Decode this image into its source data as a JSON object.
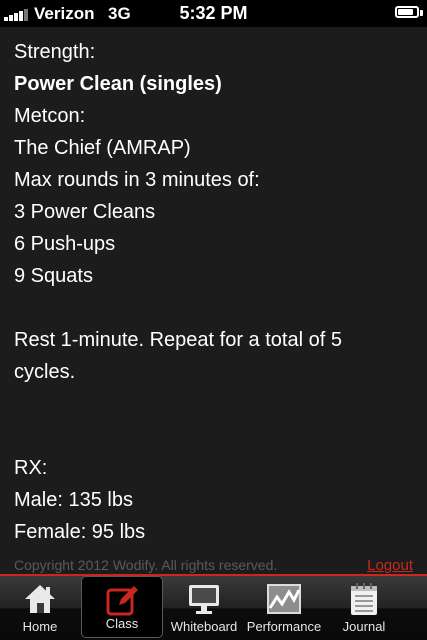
{
  "status_bar": {
    "carrier": "Verizon",
    "network": "3G",
    "time": "5:32 PM",
    "battery_level": 0.85
  },
  "workout": {
    "strength_heading": "Strength:",
    "strength_movement": "Power Clean  (singles)",
    "metcon_heading": "Metcon:",
    "metcon_name": "The Chief  (AMRAP)",
    "lines": [
      "Max rounds in 3 minutes of:",
      "3 Power Cleans",
      "6 Push-ups",
      "9 Squats"
    ],
    "rest_line_1": "Rest 1-minute. Repeat for a total of 5",
    "rest_line_2": "cycles.",
    "rx_heading": "RX:",
    "rx_male": "Male:  135 lbs",
    "rx_female": "Female:  95 lbs"
  },
  "footer": {
    "copyright": "Copyright 2012 Wodify. All rights reserved.",
    "logout_label": "Logout"
  },
  "colors": {
    "accent_red": "#c8281e",
    "background": "#1c1c1c"
  },
  "tab_bar": {
    "active_tab": "Class",
    "tabs": [
      {
        "label": "Home",
        "icon": "home-icon"
      },
      {
        "label": "Class",
        "icon": "pencil-box-icon"
      },
      {
        "label": "Whiteboard",
        "icon": "monitor-icon"
      },
      {
        "label": "Performance",
        "icon": "line-graph-icon"
      },
      {
        "label": "Journal",
        "icon": "notepad-icon"
      }
    ]
  }
}
